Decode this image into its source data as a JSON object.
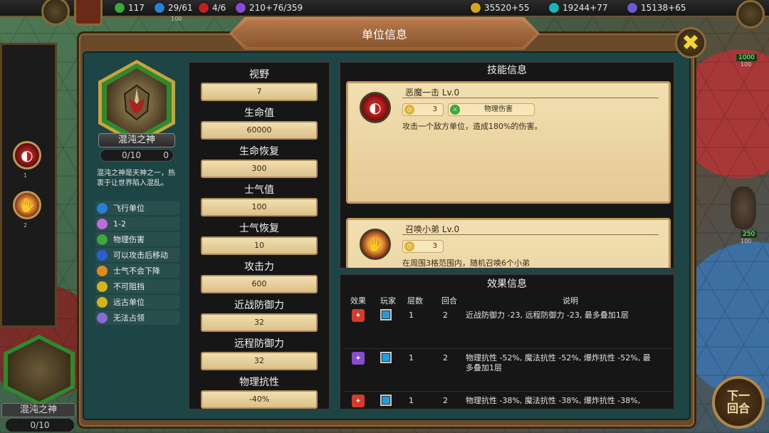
{
  "hud": {
    "res1": "117",
    "res2": "29/61",
    "res3": "4/6",
    "res4": "210+76/359",
    "gold": "35520+55",
    "gems": "19244+77",
    "mana": "15138+65"
  },
  "map_units": {
    "top_right_hp": "1000",
    "top_right_sub": "100",
    "mid_right_hp": "250",
    "mid_right_sub": "100",
    "top_left_tag": "100"
  },
  "left_strip": {
    "skill1_num": "1",
    "skill2_num": "2",
    "bottom_name": "混沌之神",
    "bottom_count": "0/10"
  },
  "next_turn_label": "下一回合",
  "panel": {
    "title": "单位信息",
    "unit_name": "混沌之神",
    "unit_count": "0/10",
    "unit_count_extra": "0",
    "description": "混沌之神是天神之一，热衷于让世界陷入混乱。",
    "traits": [
      {
        "label": "飞行单位",
        "icon": "flying-icon",
        "color": "#2a7fd4"
      },
      {
        "label": "1-2",
        "icon": "range-icon",
        "color": "#c26ad8"
      },
      {
        "label": "物理伤害",
        "icon": "sword-icon",
        "color": "#3aa83a"
      },
      {
        "label": "可以攻击后移动",
        "icon": "move-icon",
        "color": "#2a5fd4"
      },
      {
        "label": "士气不会下降",
        "icon": "morale-icon",
        "color": "#e08a1a"
      },
      {
        "label": "不可阻挡",
        "icon": "unstoppable-icon",
        "color": "#d4b41a"
      },
      {
        "label": "远古单位",
        "icon": "ancient-icon",
        "color": "#d4b41a"
      },
      {
        "label": "无法占领",
        "icon": "no-capture-icon",
        "color": "#8a6ad4"
      }
    ]
  },
  "stats": [
    {
      "label": "视野",
      "value": "7"
    },
    {
      "label": "生命值",
      "value": "60000"
    },
    {
      "label": "生命恢复",
      "value": "300"
    },
    {
      "label": "士气值",
      "value": "100"
    },
    {
      "label": "士气恢复",
      "value": "10"
    },
    {
      "label": "攻击力",
      "value": "600"
    },
    {
      "label": "近战防御力",
      "value": "32"
    },
    {
      "label": "远程防御力",
      "value": "32"
    },
    {
      "label": "物理抗性",
      "value": "-40%"
    }
  ],
  "skills": {
    "title": "技能信息",
    "items": [
      {
        "name": "恶魔一击 Lv.0",
        "cooldown": "3",
        "damage_type": "物理伤害",
        "desc": "攻击一个敌方单位，造成180%的伤害。"
      },
      {
        "name": "召唤小弟 Lv.0",
        "cooldown": "3",
        "desc": "在周围3格范围内，随机召唤6个小弟"
      }
    ]
  },
  "effects": {
    "title": "效果信息",
    "headers": {
      "effect": "效果",
      "player": "玩家",
      "stacks": "层数",
      "turns": "回合",
      "desc": "说明"
    },
    "rows": [
      {
        "stacks": "1",
        "turns": "2",
        "desc": "近战防御力 -23, 远程防御力 -23, 最多叠加1层",
        "icon_color": "#d83a2a"
      },
      {
        "stacks": "1",
        "turns": "2",
        "desc": "物理抗性 -52%, 魔法抗性 -52%, 爆炸抗性 -52%, 最多叠加1层",
        "icon_color": "#8a4ad4"
      },
      {
        "stacks": "1",
        "turns": "2",
        "desc": "物理抗性 -38%, 魔法抗性 -38%, 爆炸抗性 -38%,",
        "icon_color": "#d83a2a"
      }
    ]
  }
}
